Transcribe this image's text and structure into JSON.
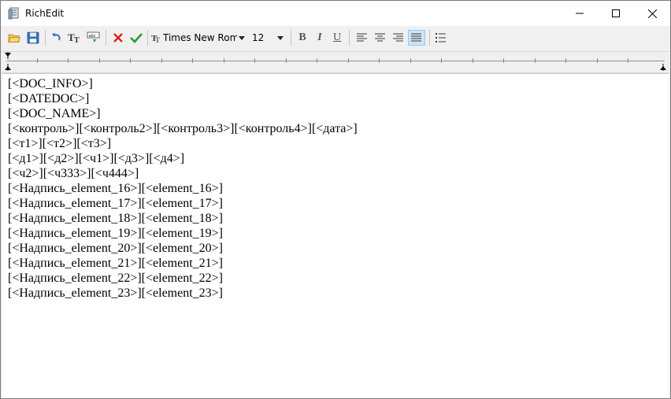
{
  "window": {
    "title": "RichEdit"
  },
  "toolbar": {
    "buttons": [
      {
        "name": "open-folder-icon"
      },
      {
        "name": "save-disk-icon"
      },
      {
        "name": "undo-icon"
      },
      {
        "name": "font-icon"
      },
      {
        "name": "insert-field-icon"
      },
      {
        "name": "cancel-icon",
        "color": "#e0201b"
      },
      {
        "name": "apply-icon",
        "color": "#2e9b2e"
      }
    ],
    "font_name": "Times New Roman",
    "font_size": "12",
    "bold_label": "B",
    "italic_label": "I",
    "underline_label": "U"
  },
  "document": {
    "lines": [
      "[<DOC_INFO>]",
      "[<DATEDOC>]",
      "[<DOC_NAME>]",
      "[<контроль>][<контроль2>][<контроль3>][<контроль4>][<дата>]",
      "[<т1>][<т2>][<т3>]",
      "[<д1>][<д2>][<ч1>][<д3>][<д4>]",
      "[<ч2>][<ч333>][<ч444>]",
      "[<Надпись_element_16>][<element_16>]",
      "[<Надпись_element_17>][<element_17>]",
      "[<Надпись_element_18>][<element_18>]",
      "[<Надпись_element_19>][<element_19>]",
      "[<Надпись_element_20>][<element_20>]",
      "[<Надпись_element_21>][<element_21>]",
      "[<Надпись_element_22>][<element_22>]",
      "[<Надпись_element_23>][<element_23>]"
    ]
  }
}
